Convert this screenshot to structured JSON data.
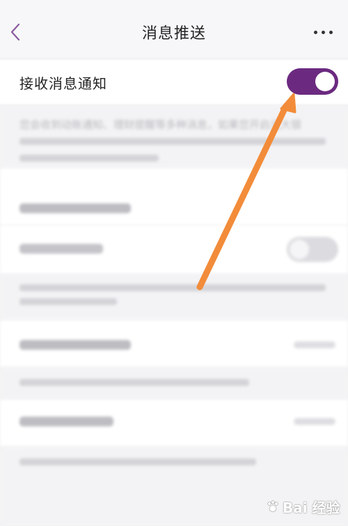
{
  "header": {
    "title": "消息推送"
  },
  "receive_notifications": {
    "label": "接收消息通知",
    "enabled": true
  },
  "description": {
    "text": "您会收到动账通知、理财提醒等多种消息，如果您开启光大银"
  },
  "watermark": {
    "text": "Bai 经验"
  },
  "colors": {
    "accent": "#6b2a80",
    "annotation_arrow": "#f28c3a",
    "background": "#f3f3f5"
  }
}
